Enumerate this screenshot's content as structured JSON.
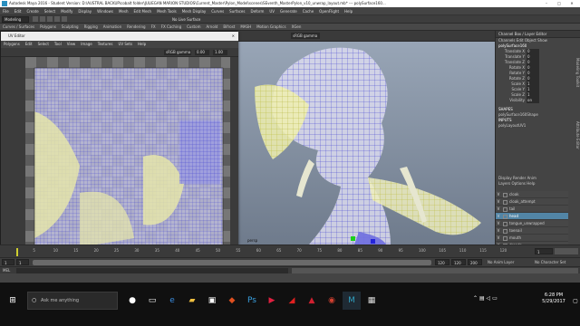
{
  "titlebar": {
    "title": "Autodesk Maya 2016 - Student Version: D:\\AUSTRAL BACKUP\\cobalt folder\\JULIEGAN MARION STUDIOS\\Current_Master\\Pylon_Model\\scenes\\SEventh_MasterPylon_v10_unwrap_layout.mb* --- polySurface160...",
    "minimize": "–",
    "maximize": "□",
    "close": "✕"
  },
  "menubar": [
    "File",
    "Edit",
    "Create",
    "Select",
    "Modify",
    "Display",
    "Windows",
    "Mesh",
    "Edit Mesh",
    "Mesh Tools",
    "Mesh Display",
    "Curves",
    "Surfaces",
    "Deform",
    "UV",
    "Generate",
    "Cache",
    "OpenFlight",
    "Help"
  ],
  "statusline": {
    "mode": "Modeling",
    "no_live": "No Live Surface"
  },
  "shelf": [
    "Curves / Surfaces",
    "Polygons",
    "Sculpting",
    "Rigging",
    "Animation",
    "Rendering",
    "FX",
    "FX Caching",
    "Custom",
    "Arnold",
    "Bifrost",
    "MASH",
    "Motion Graphics",
    "XGen"
  ],
  "viewport": {
    "menu": [
      "View",
      "Shading",
      "Lighting",
      "Show",
      "Renderer",
      "Panels"
    ],
    "camera_label": "persp",
    "shading_label": "sRGB gamma",
    "persp_label": "persp"
  },
  "uv_editor": {
    "title": "UV Editor",
    "menu": [
      "Polygons",
      "Edit",
      "Select",
      "Tool",
      "View",
      "Image",
      "Textures",
      "UV Sets",
      "Help"
    ],
    "gamma": "sRGB gamma",
    "value_a": "0.00",
    "value_b": "1.00"
  },
  "channel_box": {
    "header": "Channel Box / Layer Editor",
    "tabs": [
      "Channels",
      "Edit",
      "Object",
      "Show"
    ],
    "object_name": "polySurface160",
    "attributes": [
      {
        "name": "Translate X",
        "value": "0"
      },
      {
        "name": "Translate Y",
        "value": "0"
      },
      {
        "name": "Translate Z",
        "value": "0"
      },
      {
        "name": "Rotate X",
        "value": "0"
      },
      {
        "name": "Rotate Y",
        "value": "0"
      },
      {
        "name": "Rotate Z",
        "value": "0"
      },
      {
        "name": "Scale X",
        "value": "1"
      },
      {
        "name": "Scale Y",
        "value": "1"
      },
      {
        "name": "Scale Z",
        "value": "1"
      },
      {
        "name": "Visibility",
        "value": "on"
      }
    ],
    "shapes_label": "SHAPES",
    "shape_name": "polySurface160Shape",
    "inputs_label": "INPUTS",
    "input_name": "polyLayoutUV1"
  },
  "layer_editor": {
    "tabs": [
      "Display",
      "Render",
      "Anim"
    ],
    "menu": [
      "Layers",
      "Options",
      "Help"
    ],
    "layers": [
      {
        "v": "V",
        "name": "cloak",
        "selected": false
      },
      {
        "v": "V",
        "name": "cloak_attempt",
        "selected": false
      },
      {
        "v": "V",
        "name": "tail",
        "selected": false
      },
      {
        "v": "V",
        "name": "head",
        "selected": true
      },
      {
        "v": "V",
        "name": "tongue_unwrapped",
        "selected": false
      },
      {
        "v": "V",
        "name": "toenail",
        "selected": false
      },
      {
        "v": "V",
        "name": "mouth",
        "selected": false
      },
      {
        "v": "V",
        "name": "dreads",
        "selected": false
      },
      {
        "v": "V",
        "name": "teeth",
        "selected": false
      },
      {
        "v": "V",
        "name": "WEREWOLF_BASE",
        "selected": false
      },
      {
        "v": "V",
        "name": "basemesh_dup",
        "selected": false
      }
    ]
  },
  "modeling_toolkit": "Modeling Toolkit",
  "attribute_editor": "Attribute Editor",
  "timeline": {
    "ticks": [
      "5",
      "10",
      "15",
      "20",
      "25",
      "30",
      "35",
      "40",
      "45",
      "50",
      "55",
      "60",
      "65",
      "70",
      "75",
      "80",
      "85",
      "90",
      "95",
      "100",
      "105",
      "110",
      "115",
      "120"
    ],
    "current": "1"
  },
  "range": {
    "start": "1",
    "start2": "1",
    "end": "120",
    "end2": "120",
    "end3": "200",
    "anim_layer": "No Anim Layer",
    "char_set": "No Character Set"
  },
  "cmdline": {
    "label": "MEL"
  },
  "taskbar": {
    "search_placeholder": "Ask me anything",
    "time": "6:28 PM",
    "date": "5/29/2017"
  }
}
